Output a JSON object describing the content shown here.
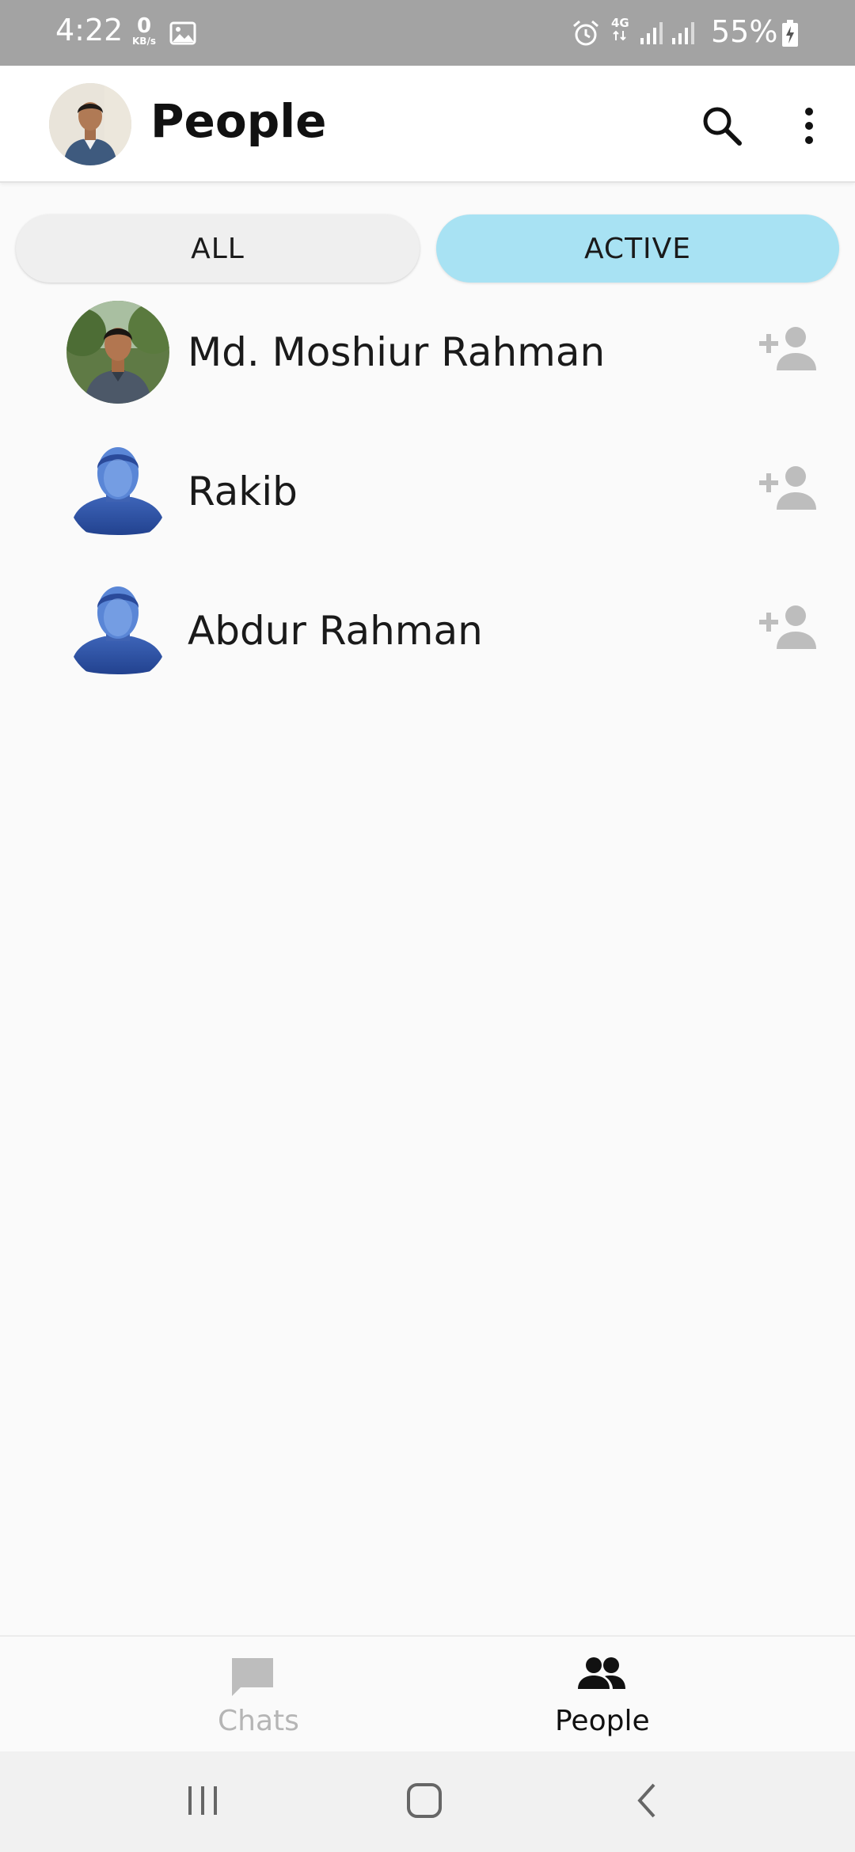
{
  "status_bar": {
    "time": "4:22",
    "net_speed_value": "0",
    "net_speed_unit": "KB/s",
    "network_type": "4G",
    "battery": "55%",
    "battery_level_percent": 55
  },
  "app_bar": {
    "title": "People"
  },
  "tabs": [
    {
      "label": "ALL",
      "selected": false
    },
    {
      "label": "ACTIVE",
      "selected": true
    }
  ],
  "people": [
    {
      "name": "Md. Moshiur Rahman",
      "avatar": "photo"
    },
    {
      "name": "Rakib",
      "avatar": "default-silhouette"
    },
    {
      "name": "Abdur Rahman",
      "avatar": "default-silhouette"
    }
  ],
  "bottom_nav": {
    "items": [
      {
        "label": "Chats",
        "icon": "chat-icon",
        "selected": false
      },
      {
        "label": "People",
        "icon": "people-icon",
        "selected": true
      }
    ]
  },
  "colors": {
    "active_tab_bg": "#a8e2f3",
    "inactive_tab_bg": "#efefef",
    "status_bar_bg": "#a3a3a3",
    "add_icon": "#bdbdbd",
    "inactive_nav": "#b5b5b5"
  }
}
